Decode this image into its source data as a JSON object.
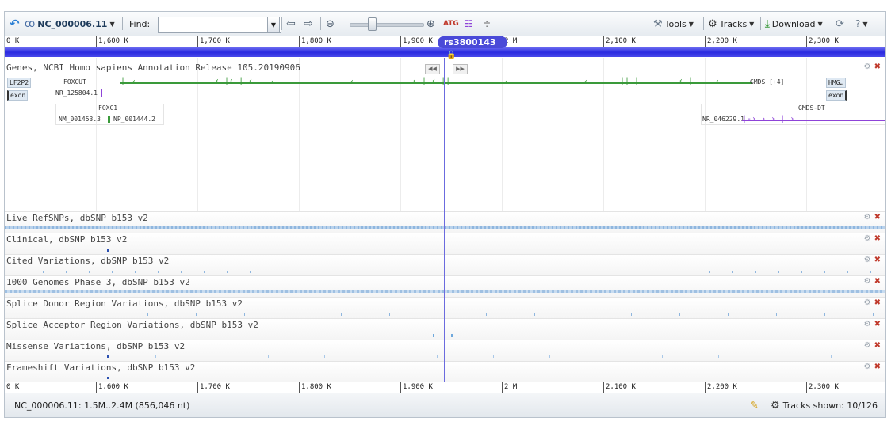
{
  "toolbar": {
    "accession": "NC_000006.11",
    "find_label": "Find:",
    "find_value": "",
    "tools_label": "Tools",
    "tracks_label": "Tracks",
    "download_label": "Download",
    "help_label": "?"
  },
  "ruler": {
    "labels": [
      "0 K",
      "1,600 K",
      "1,700 K",
      "1,800 K",
      "1,900 K",
      "2 M",
      "2,100 K",
      "2,200 K",
      "2,300 K"
    ]
  },
  "marker": {
    "label": "rs3800143"
  },
  "genes_track": {
    "title": "Genes, NCBI Homo sapiens Annotation Release 105.20190906",
    "items": {
      "lf2p2": "LF2P2",
      "exon_left": "exon",
      "foxcut": "FOXCUT",
      "foxcut_acc": "NR_125804.1",
      "foxc1": "FOXC1",
      "foxc1_nm": "NM_001453.3",
      "foxc1_np": "NP_001444.2",
      "gmds": "GMDS [+4]",
      "hmg": "HMG…",
      "exon_right": "exon",
      "gmds_dt": "GMDS-DT",
      "gmds_dt_acc": "NR_046229.1"
    }
  },
  "tracks": [
    {
      "title": "Live RefSNPs, dbSNP b153 v2"
    },
    {
      "title": "Clinical, dbSNP b153 v2"
    },
    {
      "title": "Cited Variations, dbSNP b153 v2"
    },
    {
      "title": "1000 Genomes Phase 3, dbSNP b153 v2"
    },
    {
      "title": "Splice Donor Region Variations, dbSNP b153 v2"
    },
    {
      "title": "Splice Acceptor Region Variations, dbSNP b153 v2"
    },
    {
      "title": "Missense Variations, dbSNP b153 v2"
    },
    {
      "title": "Frameshift Variations, dbSNP b153 v2"
    }
  ],
  "status": {
    "range": "NC_000006.11: 1.5M..2.4M (856,046 nt)",
    "tracks_shown": "Tracks shown: 10/126"
  },
  "colors": {
    "accent": "#3a3ade",
    "gene_green": "#3a9a3a",
    "gene_purple": "#8e44d8",
    "snp_blue": "#6fa8dc"
  }
}
